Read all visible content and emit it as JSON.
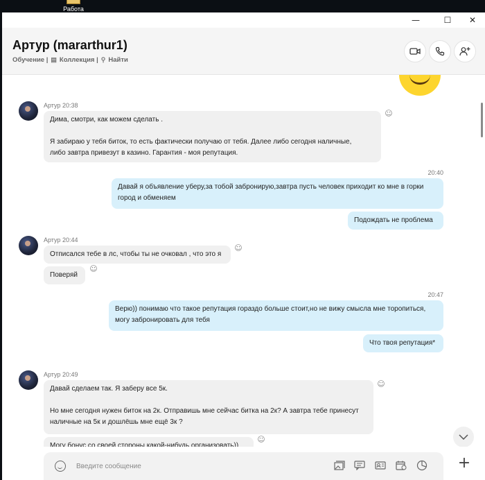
{
  "desktop": {
    "shortcut_label": "Работа"
  },
  "window": {
    "minimize": "—",
    "maximize": "☐",
    "close": "✕"
  },
  "header": {
    "title": "Артур (mararthur1)",
    "nav": {
      "item1": "Обучение |",
      "item2": "Коллекция |",
      "item3": "Найти"
    },
    "buttons": {
      "video": "video-call-icon",
      "call": "phone-icon",
      "add": "add-person-icon"
    }
  },
  "messages": {
    "g1": {
      "sender_time": "Артур 20:38",
      "m1": "Дима, смотри, как можем сделать .\n\nЯ забираю у тебя биток, то есть фактически получаю от тебя. Далее либо сегодня наличные,\nлибо завтра привезут в казино. Гарантия - моя репутация."
    },
    "g2": {
      "time": "20:40",
      "m1": "Давай я объявление уберу,за тобой забронирую,завтра пусть человек приходит ко мне в горки\nгород и обменяем",
      "m2": "Подождать не проблема"
    },
    "g3": {
      "sender_time": "Артур 20:44",
      "m1": "Отписался тебе в лс, чтобы ты не очковал , что это я",
      "m2": "Поверяй"
    },
    "g4": {
      "time": "20:47",
      "m1": "Верю)) понимаю что такое репутация гораздо больше стоит,но не вижу смысла мне торопиться,\nмогу забронировать для тебя",
      "m2": "Что твоя репутация*"
    },
    "g5": {
      "sender_time": "Артур 20:49",
      "m1": "Давай сделаем так. Я заберу все 5к.\n\nНо мне сегодня нужен биток на 2к. Отправишь мне сейчас битка на 2к? А завтра тебе принесут\nналичные на 5к и дошлёшь мне ещё 3к ?",
      "m2": "Могу бонус со своей стороны какой-нибудь организовать))"
    }
  },
  "composer": {
    "placeholder": "Введите сообщение"
  }
}
